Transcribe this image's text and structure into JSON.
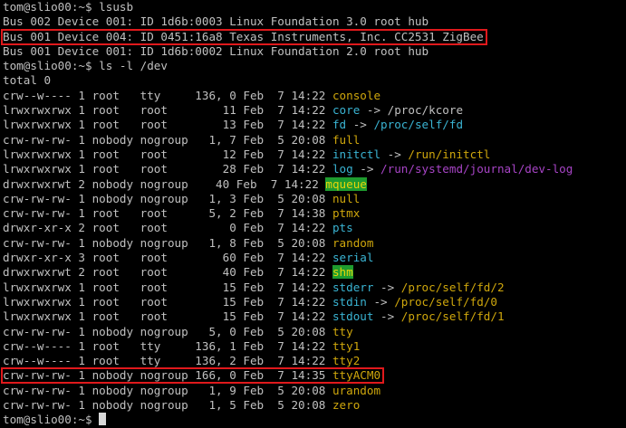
{
  "colors": {
    "bg": "#000000",
    "fg": "#c0c0c0",
    "cyan": "#3ab4d3",
    "yellow": "#cfa70c",
    "magenta": "#a744c6",
    "hl_bg": "#1e9b2e",
    "hl_fg": "#e8d50a",
    "highlight_box": "#e0191c"
  },
  "terminal": {
    "lines": [
      [
        {
          "t": "tom@slio00:~$ lsusb"
        }
      ],
      [
        {
          "t": "Bus 002 Device 001: ID 1d6b:0003 Linux Foundation 3.0 root hub"
        }
      ],
      [
        {
          "t": "Bus 001 Device 004: ID 0451:16a8 Texas Instruments, Inc. CC2531 ZigBee"
        }
      ],
      [
        {
          "t": "Bus 001 Device 001: ID 1d6b:0002 Linux Foundation 2.0 root hub"
        }
      ],
      [
        {
          "t": "tom@slio00:~$ ls -l /dev"
        }
      ],
      [
        {
          "t": "total 0"
        }
      ],
      [
        {
          "t": "crw--w---- 1 root   tty     136, 0 Feb  7 14:22 "
        },
        {
          "t": "console",
          "c": "yellow"
        }
      ],
      [
        {
          "t": "lrwxrwxrwx 1 root   root        11 Feb  7 14:22 "
        },
        {
          "t": "core",
          "c": "cyan"
        },
        {
          "t": " -> /proc/kcore"
        }
      ],
      [
        {
          "t": "lrwxrwxrwx 1 root   root        13 Feb  7 14:22 "
        },
        {
          "t": "fd",
          "c": "cyan"
        },
        {
          "t": " -> "
        },
        {
          "t": "/proc/self/fd",
          "c": "cyan"
        }
      ],
      [
        {
          "t": "crw-rw-rw- 1 nobody nogroup   1, 7 Feb  5 20:08 "
        },
        {
          "t": "full",
          "c": "yellow"
        }
      ],
      [
        {
          "t": "lrwxrwxrwx 1 root   root        12 Feb  7 14:22 "
        },
        {
          "t": "initctl",
          "c": "cyan"
        },
        {
          "t": " -> "
        },
        {
          "t": "/run/initctl",
          "c": "yellow"
        }
      ],
      [
        {
          "t": "lrwxrwxrwx 1 root   root        28 Feb  7 14:22 "
        },
        {
          "t": "log",
          "c": "cyan"
        },
        {
          "t": " -> "
        },
        {
          "t": "/run/systemd/journal/dev-log",
          "c": "magenta"
        }
      ],
      [
        {
          "t": "drwxrwxrwt 2 nobody nogroup    40 Feb  7 14:22 "
        },
        {
          "t": "mqueue",
          "c": "hl"
        }
      ],
      [
        {
          "t": "crw-rw-rw- 1 nobody nogroup   1, 3 Feb  5 20:08 "
        },
        {
          "t": "null",
          "c": "yellow"
        }
      ],
      [
        {
          "t": "crw-rw-rw- 1 root   root      5, 2 Feb  7 14:38 "
        },
        {
          "t": "ptmx",
          "c": "yellow"
        }
      ],
      [
        {
          "t": "drwxr-xr-x 2 root   root         0 Feb  7 14:22 "
        },
        {
          "t": "pts",
          "c": "cyan"
        }
      ],
      [
        {
          "t": "crw-rw-rw- 1 nobody nogroup   1, 8 Feb  5 20:08 "
        },
        {
          "t": "random",
          "c": "yellow"
        }
      ],
      [
        {
          "t": "drwxr-xr-x 3 root   root        60 Feb  7 14:22 "
        },
        {
          "t": "serial",
          "c": "cyan"
        }
      ],
      [
        {
          "t": "drwxrwxrwt 2 root   root        40 Feb  7 14:22 "
        },
        {
          "t": "shm",
          "c": "hl"
        }
      ],
      [
        {
          "t": "lrwxrwxrwx 1 root   root        15 Feb  7 14:22 "
        },
        {
          "t": "stderr",
          "c": "cyan"
        },
        {
          "t": " -> "
        },
        {
          "t": "/proc/self/fd/2",
          "c": "yellow"
        }
      ],
      [
        {
          "t": "lrwxrwxrwx 1 root   root        15 Feb  7 14:22 "
        },
        {
          "t": "stdin",
          "c": "cyan"
        },
        {
          "t": " -> "
        },
        {
          "t": "/proc/self/fd/0",
          "c": "yellow"
        }
      ],
      [
        {
          "t": "lrwxrwxrwx 1 root   root        15 Feb  7 14:22 "
        },
        {
          "t": "stdout",
          "c": "cyan"
        },
        {
          "t": " -> "
        },
        {
          "t": "/proc/self/fd/1",
          "c": "yellow"
        }
      ],
      [
        {
          "t": "crw-rw-rw- 1 nobody nogroup   5, 0 Feb  5 20:08 "
        },
        {
          "t": "tty",
          "c": "yellow"
        }
      ],
      [
        {
          "t": "crw--w---- 1 root   tty     136, 1 Feb  7 14:22 "
        },
        {
          "t": "tty1",
          "c": "yellow"
        }
      ],
      [
        {
          "t": "crw--w---- 1 root   tty     136, 2 Feb  7 14:22 "
        },
        {
          "t": "tty2",
          "c": "yellow"
        }
      ],
      [
        {
          "t": "crw-rw-rw- 1 nobody nogroup 166, 0 Feb  7 14:35 "
        },
        {
          "t": "ttyACM0",
          "c": "yellow"
        }
      ],
      [
        {
          "t": "crw-rw-rw- 1 nobody nogroup   1, 9 Feb  5 20:08 "
        },
        {
          "t": "urandom",
          "c": "yellow"
        }
      ],
      [
        {
          "t": "crw-rw-rw- 1 nobody nogroup   1, 5 Feb  5 20:08 "
        },
        {
          "t": "zero",
          "c": "yellow"
        }
      ],
      [
        {
          "t": "tom@slio00:~$ "
        }
      ]
    ],
    "highlighted_lines": [
      2,
      25
    ]
  }
}
